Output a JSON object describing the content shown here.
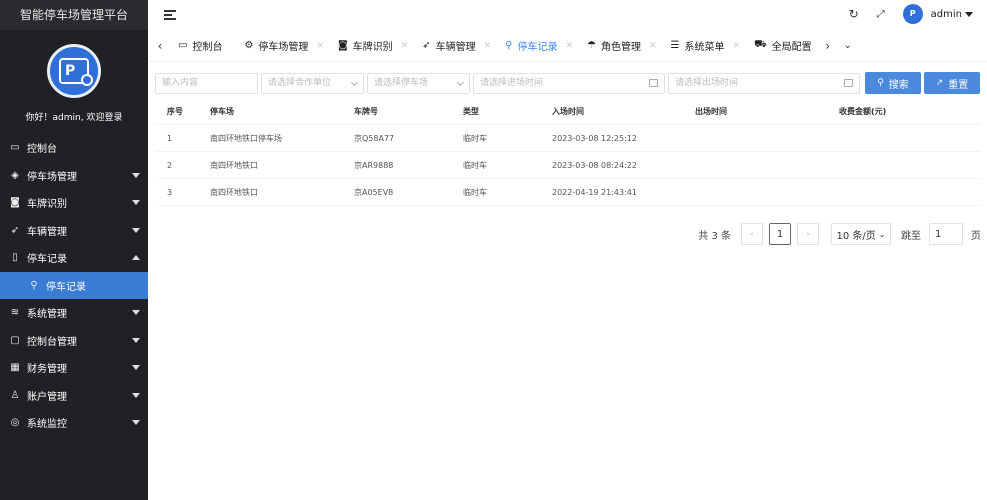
{
  "sidebar": {
    "brand": "智能停车场管理平台",
    "welcome": "你好！admin, 欢迎登录",
    "items": [
      {
        "label": "控制台",
        "icon": "▭"
      },
      {
        "label": "停车场管理",
        "icon": "◈"
      },
      {
        "label": "车牌识别",
        "icon": "◙"
      },
      {
        "label": "车辆管理",
        "icon": "➶"
      },
      {
        "label": "停车记录",
        "icon": "▯"
      },
      {
        "label": "停车记录",
        "icon": "⚲"
      },
      {
        "label": "系统管理",
        "icon": "≋"
      },
      {
        "label": "控制台管理",
        "icon": "▢"
      },
      {
        "label": "财务管理",
        "icon": "▦"
      },
      {
        "label": "账户管理",
        "icon": "♙"
      },
      {
        "label": "系统监控",
        "icon": "◎"
      }
    ]
  },
  "topbar": {
    "username": "admin",
    "avatar_text": "P"
  },
  "tabs": [
    {
      "label": "控制台",
      "icon": "▭"
    },
    {
      "label": "停车场管理",
      "icon": "⚙"
    },
    {
      "label": "车牌识别",
      "icon": "◙"
    },
    {
      "label": "车辆管理",
      "icon": "➶"
    },
    {
      "label": "停车记录",
      "icon": "⚲"
    },
    {
      "label": "角色管理",
      "icon": "☂"
    },
    {
      "label": "系统菜单",
      "icon": "☰"
    },
    {
      "label": "全局配置",
      "icon": "⛟"
    }
  ],
  "filters": {
    "content_placeholder": "输入内容",
    "unit_placeholder": "请选择合作单位",
    "lot_placeholder": "请选择停车场",
    "entry_time_placeholder": "请选择进场时间",
    "exit_time_placeholder": "请选择出场时间",
    "search_label": "搜索",
    "reset_label": "重置"
  },
  "table": {
    "headers": [
      "序号",
      "停车场",
      "车牌号",
      "类型",
      "入场时间",
      "出场时间",
      "收费金额(元)"
    ],
    "rows": [
      [
        "1",
        "南四环地铁口停车场",
        "京Q58A77",
        "临时车",
        "2023-03-08 12:25:12",
        "",
        ""
      ],
      [
        "2",
        "南四环地铁口",
        "京AR9888",
        "临时车",
        "2023-03-08 08:24:22",
        "",
        ""
      ],
      [
        "3",
        "南四环地铁口",
        "京A05EV8",
        "临时车",
        "2022-04-19 21:43:41",
        "",
        ""
      ]
    ]
  },
  "pagination": {
    "total": "共 3 条",
    "current_page": "1",
    "page_size": "10 条/页",
    "goto_label": "跳至",
    "goto_value": "1",
    "page_suffix": "页"
  },
  "colors": {
    "sidebar_bg": "#202124",
    "accent": "#3a86ff",
    "button": "#4a89dc"
  }
}
